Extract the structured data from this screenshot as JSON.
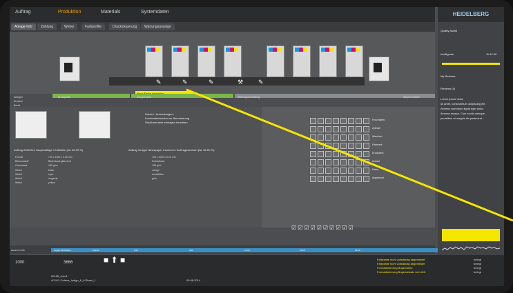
{
  "colors": {
    "accent": "#f0a000",
    "highlight": "#f5e600",
    "status_green": "#7ab648",
    "timeline": "#3a8fc2",
    "brand": "#9ecdf0"
  },
  "topbar": {
    "tabs": [
      "Auftrag",
      "Produktion",
      "Materials",
      "Systemdaten"
    ],
    "active_tab": 1
  },
  "subtabs": [
    "Anlage-Info",
    "Zählung",
    "Werke",
    "Farbprofile",
    "Drucksteuerung",
    "Wartungsanzeige"
  ],
  "press": {
    "hint": "Neue Farbe eintuellen"
  },
  "status": {
    "left_label": "Druckplatte",
    "mid_label": "Anlegeeinheit",
    "right_label": "Wartungsanmeldung",
    "far_right": "Stapler belastet"
  },
  "row_labels": [
    "Anlegen",
    "Drucken",
    "Bereit",
    "Ende",
    "Abl. fertig"
  ],
  "job": {
    "hint_title": "Nutzen / Anmerkungen:",
    "hint_lines": [
      "Kundenfarbmuster zur Abmusterung",
      "Strukturmuster eintragen beachten"
    ],
    "title_left": "Auftrag 2022/014 Hauptauflage / Kaltfolien (Ist: 80.00 %)",
    "title_right": "Auftrag Gruppe Newspaper Content 1 / Auftragswechsel (Ist: 80.00 %)"
  },
  "details_left": [
    "Format",
    "Bedruckstoff",
    "Grammatur",
    "Werk1",
    "Werk2",
    "Werk3",
    "Werk4"
  ],
  "details_vals": [
    "720 x 1020 x 0.20 mm",
    "Bilderdruck glänzend",
    "150 g/m²",
    "black",
    "cyan",
    "magenta",
    "yellow"
  ],
  "details_right": [
    "720 x 1020 x 0.20 mm",
    "Schaufloten",
    "135 g/m²",
    "orange",
    "dunkelblau",
    "grün"
  ],
  "grid_labels": [
    "Feuchtwerk",
    "Zylinder",
    "Waschen",
    "Farbwerk",
    "Druckwerk",
    "Umlauf",
    "Farbe",
    "Abgetrennt"
  ],
  "timeline_labels": [
    "Leerer 0 / 8.15",
    "Jogger-Mischfarbe",
    "Stunde",
    "6:00",
    "9:00",
    "12:00",
    "15:00",
    "18:00"
  ],
  "bottom": {
    "counter": "1000",
    "counter2": "3666",
    "job_number": "80185_Job-8",
    "job_name": "4/1/4/1-Cutters_Indigo_8_4/Sheet_1",
    "date": "09.08.2014",
    "messages": [
      "Farbplatte nicht vollständig abgemeldet",
      "Farbplatte nicht vollständig abgemeldet",
      "Formatänderung Bogenweite",
      "Formatänderung Bogenabsatz vom A.B."
    ],
    "msg_status": [
      "belegt",
      "belegt",
      "belegt",
      "belegt"
    ]
  },
  "sidebar": {
    "title": "HEIDELBERG",
    "items": [
      {
        "label": "Quality Assist"
      },
      {
        "label": "Intelligente",
        "value": "11:42:00"
      },
      {
        "label": "My Reviews"
      },
      {
        "label": "Reviews (4)"
      }
    ],
    "text": [
      "Lorem ipsum dolor",
      "sit amet, consectetuer adipiscing elit.",
      "Aenean commodo ligula eget dolor.",
      "Aenean massa. Cum sociis natoque",
      "penatibus et magnis dis parturient..."
    ]
  }
}
